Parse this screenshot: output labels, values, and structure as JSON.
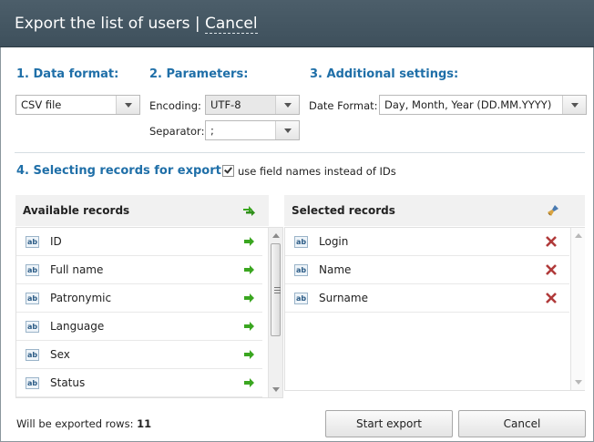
{
  "header": {
    "title": "Export the list of users",
    "separator": "|",
    "cancel_link": "Cancel"
  },
  "data_format": {
    "heading": "1. Data format:",
    "value": "CSV file"
  },
  "parameters": {
    "heading": "2. Parameters:",
    "encoding_label": "Encoding:",
    "encoding_value": "UTF-8",
    "separator_label": "Separator:",
    "separator_value": ";"
  },
  "additional": {
    "heading": "3. Additional settings:",
    "date_format_label": "Date Format:",
    "date_format_value": "Day, Month, Year (DD.MM.YYYY)"
  },
  "records": {
    "heading": "4. Selecting records for export:",
    "checkbox_label": "use field names instead of IDs",
    "checkbox_checked": true,
    "available_title": "Available records",
    "selected_title": "Selected records",
    "field_type_badge": "ab",
    "available": [
      "ID",
      "Full name",
      "Patronymic",
      "Language",
      "Sex",
      "Status"
    ],
    "selected": [
      "Login",
      "Name",
      "Surname"
    ]
  },
  "footer": {
    "rows_label": "Will be exported rows:",
    "rows_count": "11",
    "start_button": "Start export",
    "cancel_button": "Cancel"
  },
  "colors": {
    "accent": "#1f6fa8",
    "titlebar": "#45575f",
    "add_arrow": "#3aa620",
    "delete_x": "#b03a3a"
  },
  "icons": {
    "add_all": "double-green-arrow-icon",
    "clear_all": "broom-icon",
    "add": "green-arrow-icon",
    "remove": "red-x-icon",
    "field": "ab-field-icon"
  }
}
